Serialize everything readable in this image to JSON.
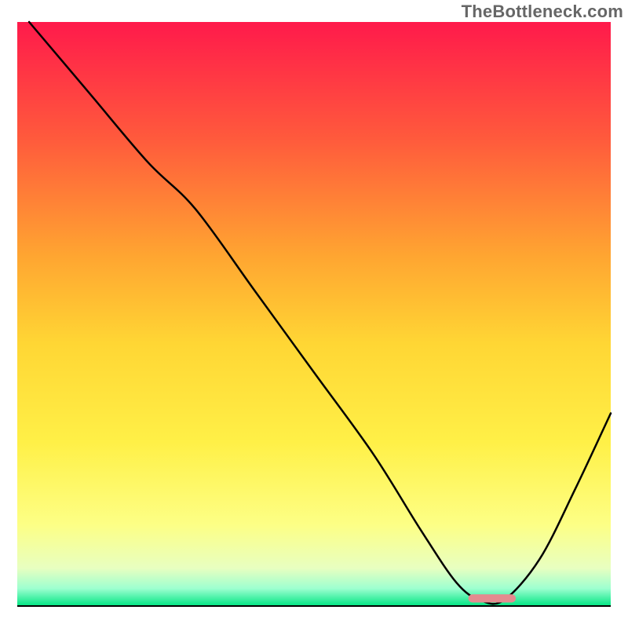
{
  "watermark": "TheBottleneck.com",
  "chart_data": {
    "type": "line",
    "title": "",
    "xlabel": "",
    "ylabel": "",
    "xlim": [
      0,
      100
    ],
    "ylim": [
      0,
      100
    ],
    "grid": false,
    "legend": false,
    "background_gradient": {
      "stops": [
        {
          "offset": 0.0,
          "color": "#ff1a4b"
        },
        {
          "offset": 0.2,
          "color": "#ff5a3c"
        },
        {
          "offset": 0.4,
          "color": "#ffa531"
        },
        {
          "offset": 0.55,
          "color": "#ffd634"
        },
        {
          "offset": 0.72,
          "color": "#fff047"
        },
        {
          "offset": 0.86,
          "color": "#fdff85"
        },
        {
          "offset": 0.935,
          "color": "#e8ffc0"
        },
        {
          "offset": 0.97,
          "color": "#9dffd0"
        },
        {
          "offset": 1.0,
          "color": "#00e583"
        }
      ]
    },
    "series": [
      {
        "name": "bottleneck-curve",
        "color": "#000000",
        "stroke_width": 2.5,
        "x": [
          2,
          12,
          22,
          30,
          40,
          50,
          60,
          68,
          74,
          78,
          82,
          88,
          94,
          100
        ],
        "y": [
          100,
          88,
          76,
          68,
          54,
          40,
          26,
          13,
          4,
          1,
          1,
          8,
          20,
          33
        ]
      }
    ],
    "marker": {
      "name": "optimal-range",
      "color": "#e48b8f",
      "x_center": 80,
      "y": 1.3,
      "width": 8,
      "height": 1.4,
      "radius": 0.7
    }
  }
}
